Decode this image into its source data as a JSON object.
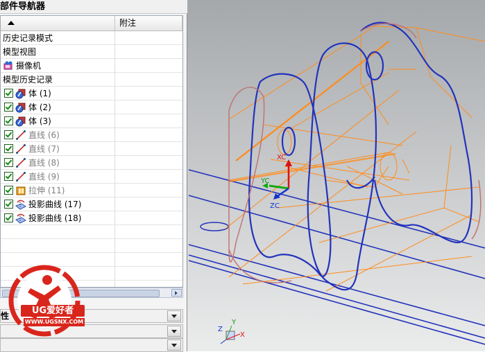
{
  "navigator": {
    "title": "部件导航器",
    "columns": {
      "name": "",
      "note": "附注"
    },
    "items": [
      {
        "label": "历史记录模式",
        "check": false,
        "icon": "none",
        "grey": false
      },
      {
        "label": "模型视图",
        "check": false,
        "icon": "none",
        "grey": false
      },
      {
        "label": "摄像机",
        "check": false,
        "icon": "camera-icon",
        "grey": false
      },
      {
        "label": "模型历史记录",
        "check": false,
        "icon": "none",
        "grey": false
      },
      {
        "label": "体 (1)",
        "check": true,
        "icon": "body-icon",
        "grey": false
      },
      {
        "label": "体 (2)",
        "check": true,
        "icon": "body-icon",
        "grey": false
      },
      {
        "label": "体 (3)",
        "check": true,
        "icon": "body-icon",
        "grey": false
      },
      {
        "label": "直线 (6)",
        "check": true,
        "icon": "line-icon",
        "grey": true
      },
      {
        "label": "直线 (7)",
        "check": true,
        "icon": "line-icon",
        "grey": true
      },
      {
        "label": "直线 (8)",
        "check": true,
        "icon": "line-icon",
        "grey": true
      },
      {
        "label": "直线 (9)",
        "check": true,
        "icon": "line-icon",
        "grey": true
      },
      {
        "label": "拉伸 (11)",
        "check": true,
        "icon": "extrude-icon",
        "grey": true
      },
      {
        "label": "投影曲线 (17)",
        "check": true,
        "icon": "projected-curve-icon",
        "grey": false
      },
      {
        "label": "投影曲线 (18)",
        "check": true,
        "icon": "projected-curve-icon",
        "grey": false
      }
    ],
    "empty_rows": 5,
    "dropdowns": [
      "性",
      "",
      ""
    ]
  },
  "watermark": {
    "brand": "UG爱好者",
    "url": "WWW.UGSNX.COM"
  },
  "viewport": {
    "triad": {
      "x": "XC",
      "y": "YC",
      "z": "ZC"
    },
    "view_triad": {
      "x": "X",
      "y": "Y",
      "z": "Z"
    },
    "colors": {
      "curve": "#2233bb",
      "hidden": "#ff8c1a",
      "edge": "#c07070"
    }
  }
}
